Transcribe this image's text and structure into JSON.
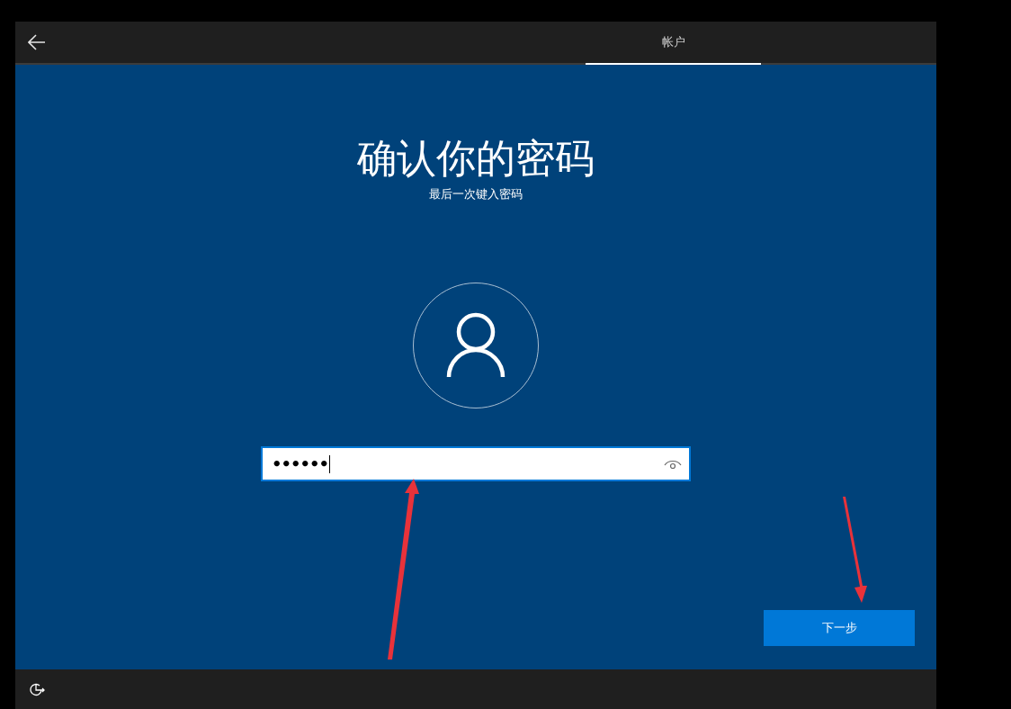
{
  "header": {
    "tabs": [
      {
        "label": "帐户",
        "selected": true
      }
    ]
  },
  "title": "确认你的密码",
  "subtitle": "最后一次键入密码",
  "password_field": {
    "value": "••••••",
    "focused": true
  },
  "next_button": {
    "label": "下一步"
  }
}
